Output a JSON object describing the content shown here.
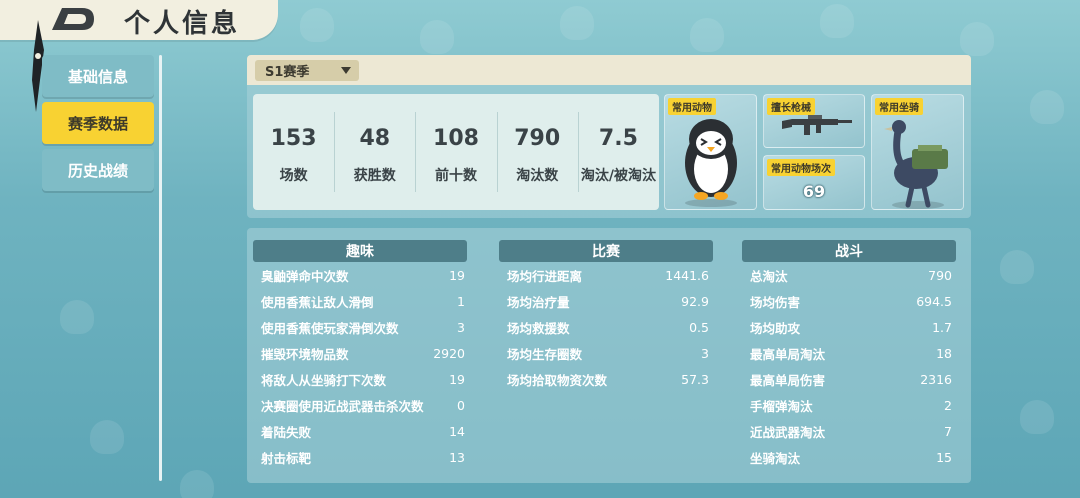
{
  "header": {
    "title": "个人信息"
  },
  "sidebar": {
    "items": [
      {
        "label": "基础信息",
        "active": false
      },
      {
        "label": "赛季数据",
        "active": true
      },
      {
        "label": "历史战绩",
        "active": false
      }
    ]
  },
  "season": {
    "selected": "S1赛季"
  },
  "summary": [
    {
      "value": "153",
      "label": "场数"
    },
    {
      "value": "48",
      "label": "获胜数"
    },
    {
      "value": "108",
      "label": "前十数"
    },
    {
      "value": "790",
      "label": "淘汰数"
    },
    {
      "value": "7.5",
      "label": "淘汰/被淘汰"
    }
  ],
  "cards": {
    "animal": {
      "tag": "常用动物",
      "icon": "penguin-character"
    },
    "weapon": {
      "tag": "擅长枪械",
      "icon": "assault-rifle"
    },
    "animal_matches": {
      "tag": "常用动物场次",
      "count": "69"
    },
    "mount": {
      "tag": "常用坐骑",
      "icon": "ostrich-mount"
    }
  },
  "sections": {
    "fun": {
      "title": "趣味",
      "rows": [
        {
          "label": "臭鼬弹命中次数",
          "value": "19"
        },
        {
          "label": "使用香蕉让敌人滑倒",
          "value": "1"
        },
        {
          "label": "使用香蕉使玩家滑倒次数",
          "value": "3"
        },
        {
          "label": "摧毁环境物品数",
          "value": "2920"
        },
        {
          "label": "将敌人从坐骑打下次数",
          "value": "19"
        },
        {
          "label": "决赛圈使用近战武器击杀次数",
          "value": "0"
        },
        {
          "label": "着陆失败",
          "value": "14"
        },
        {
          "label": "射击标靶",
          "value": "13"
        }
      ]
    },
    "match": {
      "title": "比赛",
      "rows": [
        {
          "label": "场均行进距离",
          "value": "1441.6"
        },
        {
          "label": "场均治疗量",
          "value": "92.9"
        },
        {
          "label": "场均救援数",
          "value": "0.5"
        },
        {
          "label": "场均生存圈数",
          "value": "3"
        },
        {
          "label": "场均拾取物资次数",
          "value": "57.3"
        }
      ]
    },
    "combat": {
      "title": "战斗",
      "rows": [
        {
          "label": "总淘汰",
          "value": "790"
        },
        {
          "label": "场均伤害",
          "value": "694.5"
        },
        {
          "label": "场均助攻",
          "value": "1.7"
        },
        {
          "label": "最高单局淘汰",
          "value": "18"
        },
        {
          "label": "最高单局伤害",
          "value": "2316"
        },
        {
          "label": "手榴弹淘汰",
          "value": "2"
        },
        {
          "label": "近战武器淘汰",
          "value": "7"
        },
        {
          "label": "坐骑淘汰",
          "value": "15"
        }
      ]
    }
  },
  "colors": {
    "accent": "#f8d232",
    "section_header": "#4e7e89",
    "background": "#6fb3c0"
  }
}
